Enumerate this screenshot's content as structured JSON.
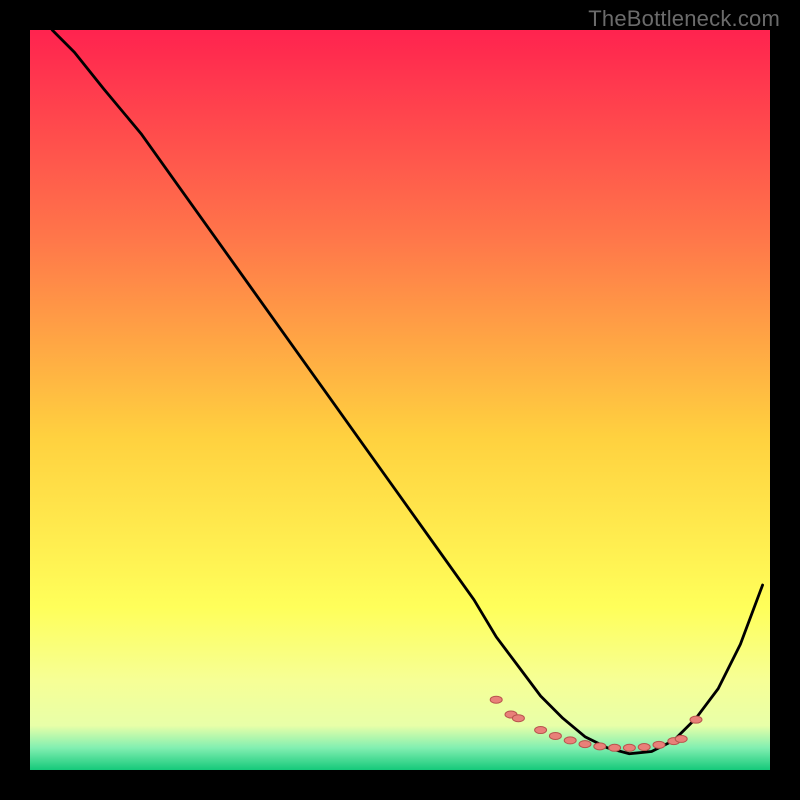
{
  "watermark": "TheBottleneck.com",
  "chart_data": {
    "type": "line",
    "title": "",
    "xlabel": "",
    "ylabel": "",
    "xlim": [
      0,
      100
    ],
    "ylim": [
      0,
      100
    ],
    "grid": false,
    "legend": false,
    "background_gradient": {
      "top": "#ff234f",
      "mid_upper": "#ff764a",
      "mid": "#ffd13f",
      "mid_lower": "#ffff5a",
      "near_bottom": "#e8ffa8",
      "bottom": "#15c97a"
    },
    "series": [
      {
        "name": "curve",
        "color": "#000000",
        "x": [
          3,
          6,
          10,
          15,
          20,
          25,
          30,
          35,
          40,
          45,
          50,
          55,
          60,
          63,
          66,
          69,
          72,
          75,
          78,
          81,
          84,
          87,
          90,
          93,
          96,
          99
        ],
        "y": [
          100,
          97,
          92,
          86,
          79,
          72,
          65,
          58,
          51,
          44,
          37,
          30,
          23,
          18,
          14,
          10,
          7,
          4.5,
          3,
          2.2,
          2.5,
          4,
          7,
          11,
          17,
          25
        ]
      }
    ],
    "markers": {
      "color": "#e98079",
      "outline": "#b8544e",
      "x": [
        63,
        65,
        66,
        69,
        71,
        73,
        75,
        77,
        79,
        81,
        83,
        85,
        87,
        88,
        90
      ],
      "y": [
        9.5,
        7.5,
        7,
        5.4,
        4.6,
        4.0,
        3.5,
        3.2,
        3.0,
        3.0,
        3.1,
        3.4,
        3.9,
        4.2,
        6.8
      ]
    }
  }
}
